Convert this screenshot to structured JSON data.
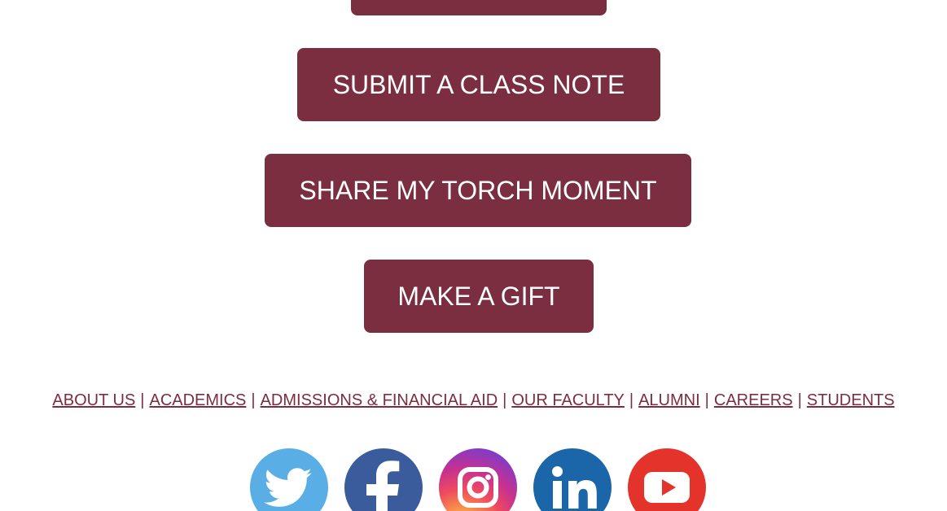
{
  "buttons": {
    "top_label": "",
    "class_note_label": "SUBMIT A CLASS NOTE",
    "torch_label": "SHARE MY TORCH MOMENT",
    "gift_label": "MAKE A GIFT"
  },
  "footer_nav": {
    "items": [
      "ABOUT US",
      "ACADEMICS",
      "ADMISSIONS & FINANCIAL AID",
      "OUR FACULTY",
      "ALUMNI",
      "CAREERS",
      "STUDENTS"
    ],
    "separator": "|"
  },
  "social": {
    "icons": [
      "twitter-icon",
      "facebook-icon",
      "instagram-icon",
      "linkedin-icon",
      "youtube-icon"
    ]
  },
  "colors": {
    "brand": "#7a2e40",
    "twitter": "#5aaee6",
    "facebook": "#3a5b9c",
    "linkedin": "#1a66a8",
    "youtube": "#e3332b"
  }
}
